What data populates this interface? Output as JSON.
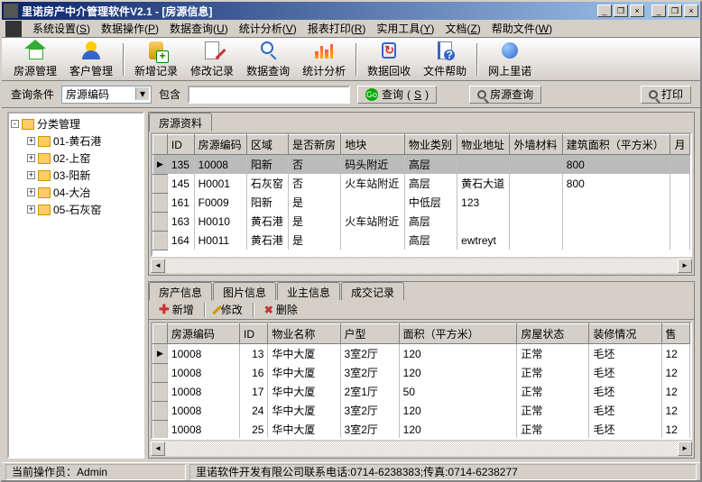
{
  "window": {
    "title": "里诺房产中介管理软件V2.1 - [房源信息]"
  },
  "menu": {
    "items": [
      {
        "label": "系统设置",
        "key": "S"
      },
      {
        "label": "数据操作",
        "key": "P"
      },
      {
        "label": "数据查询",
        "key": "U"
      },
      {
        "label": "统计分析",
        "key": "V"
      },
      {
        "label": "报表打印",
        "key": "R"
      },
      {
        "label": "实用工具",
        "key": "Y"
      },
      {
        "label": "文档",
        "key": "Z"
      },
      {
        "label": "帮助文件",
        "key": "W"
      }
    ]
  },
  "toolbar": {
    "items": [
      {
        "label": "房源管理",
        "icon": "house"
      },
      {
        "label": "客户管理",
        "icon": "people"
      },
      {
        "label": "新增记录",
        "icon": "db"
      },
      {
        "label": "修改记录",
        "icon": "edit"
      },
      {
        "label": "数据查询",
        "icon": "mag"
      },
      {
        "label": "统计分析",
        "icon": "chart"
      },
      {
        "label": "数据回收",
        "icon": "recycle"
      },
      {
        "label": "文件帮助",
        "icon": "book"
      },
      {
        "label": "网上里诺",
        "icon": "globe"
      }
    ],
    "separators_after": [
      1,
      5,
      7
    ]
  },
  "searchbar": {
    "cond_label": "查询条件",
    "field_combo": "房源编码",
    "contains_label": "包含",
    "go_label": "查询",
    "go_key": "S",
    "house_search_label": "房源查询",
    "print_label": "打印"
  },
  "tree": {
    "root": "分类管理",
    "nodes": [
      {
        "label": "01-黄石港"
      },
      {
        "label": "02-上窑"
      },
      {
        "label": "03-阳新"
      },
      {
        "label": "04-大冶"
      },
      {
        "label": "05-石灰窑"
      }
    ]
  },
  "top_grid": {
    "tab": "房源资料",
    "cols": [
      "ID",
      "房源编码",
      "区域",
      "是否新房",
      "地块",
      "物业类别",
      "物业地址",
      "外墙材料",
      "建筑面积（平方米）",
      "月"
    ],
    "rows": [
      {
        "sel": true,
        "cells": [
          "135",
          "10008",
          "阳新",
          "否",
          "码头附近",
          "高层",
          "",
          "",
          "800",
          ""
        ]
      },
      {
        "sel": false,
        "cells": [
          "145",
          "H0001",
          "石灰窑",
          "否",
          "火车站附近",
          "高层",
          "黄石大道",
          "",
          "800",
          ""
        ]
      },
      {
        "sel": false,
        "cells": [
          "161",
          "F0009",
          "阳新",
          "是",
          "",
          "中低层",
          "123",
          "",
          "",
          ""
        ]
      },
      {
        "sel": false,
        "cells": [
          "163",
          "H0010",
          "黄石港",
          "是",
          "火车站附近",
          "高层",
          "",
          "",
          "",
          ""
        ]
      },
      {
        "sel": false,
        "cells": [
          "164",
          "H0011",
          "黄石港",
          "是",
          "",
          "高层",
          "ewtreyt",
          "",
          "",
          ""
        ]
      }
    ]
  },
  "bottom_tabs": {
    "tabs": [
      "房产信息",
      "图片信息",
      "业主信息",
      "成交记录"
    ],
    "active": 0,
    "toolbar": {
      "add": "新增",
      "edit": "修改",
      "del": "删除"
    },
    "cols": [
      "房源编码",
      "ID",
      "物业名称",
      "户型",
      "面积（平方米）",
      "房屋状态",
      "装修情况",
      "售"
    ],
    "rows": [
      [
        "10008",
        "13",
        "华中大厦",
        "3室2厅",
        "120",
        "正常",
        "毛坯",
        "12"
      ],
      [
        "10008",
        "16",
        "华中大厦",
        "3室2厅",
        "120",
        "正常",
        "毛坯",
        "12"
      ],
      [
        "10008",
        "17",
        "华中大厦",
        "2室1厅",
        "50",
        "正常",
        "毛坯",
        "12"
      ],
      [
        "10008",
        "24",
        "华中大厦",
        "3室2厅",
        "120",
        "正常",
        "毛坯",
        "12"
      ],
      [
        "10008",
        "25",
        "华中大厦",
        "3室2厅",
        "120",
        "正常",
        "毛坯",
        "12"
      ]
    ]
  },
  "status": {
    "user_label": "当前操作员：",
    "user": "Admin",
    "company": "里诺软件开发有限公司联系电话:0714-6238383;传真:0714-6238277"
  }
}
